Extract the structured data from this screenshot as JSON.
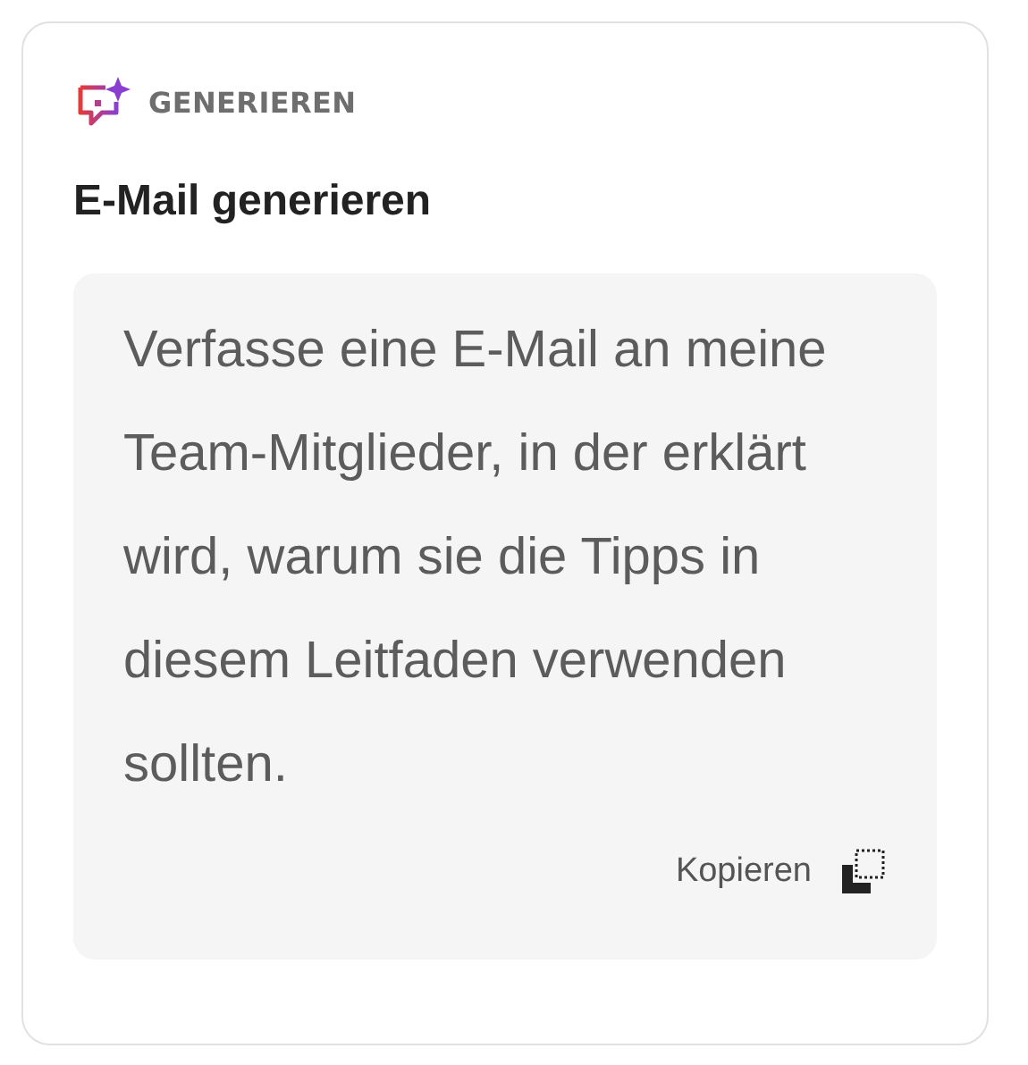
{
  "category": "GENERIEREN",
  "title": "E-Mail generieren",
  "prompt": "Verfasse eine E-Mail an meine Team-Mitglieder, in der erklärt wird, warum sie die Tipps in diesem Leitfaden verwenden sollten.",
  "copy_button": "Kopieren"
}
